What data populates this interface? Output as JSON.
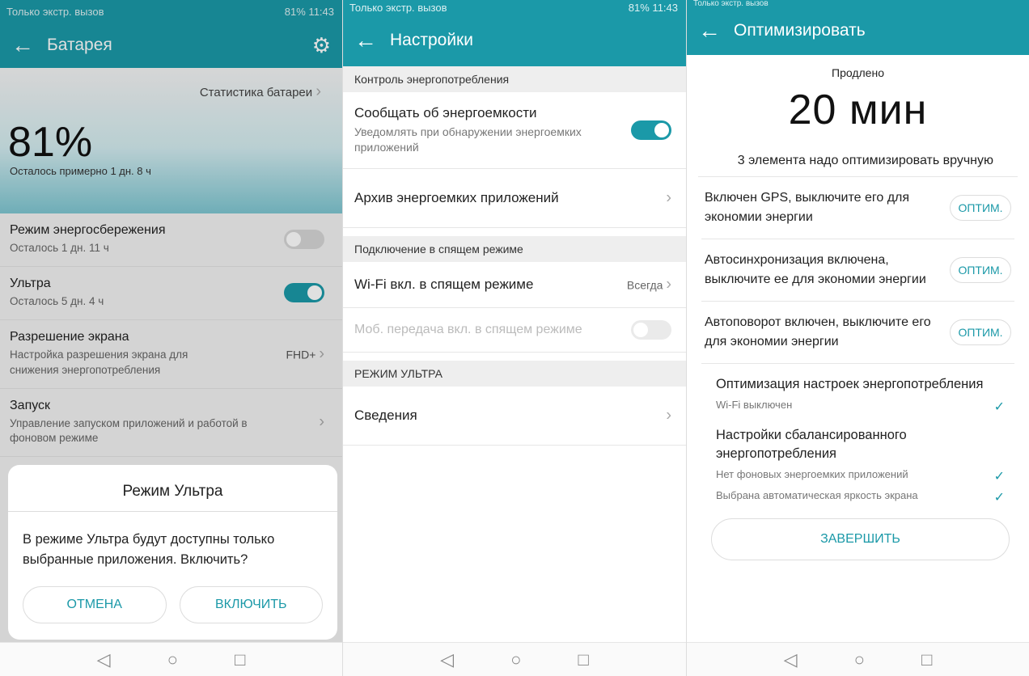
{
  "colors": {
    "accent": "#1b99a8",
    "section_bg": "#eeeeee"
  },
  "phone1": {
    "status": {
      "left": "Только экстр. вызов",
      "right": "81% 11:43"
    },
    "title": "Батарея",
    "stats_link": "Статистика батареи",
    "percent": "81%",
    "remaining": "Осталось примерно 1 дн. 8 ч",
    "rows": [
      {
        "title": "Режим энергосбережения",
        "sub": "Осталось 1 дн. 11 ч",
        "toggle_on": false
      },
      {
        "title": "Ультра",
        "sub": "Осталось 5 дн. 4 ч",
        "toggle_on": true
      },
      {
        "title": "Разрешение экрана",
        "sub": "Настройка разрешения экрана для снижения энергопотребления",
        "value": "FHD+"
      },
      {
        "title": "Запуск",
        "sub": "Управление запуском приложений и работой в фоновом режиме"
      }
    ],
    "dialog": {
      "title": "Режим Ультра",
      "message": "В режиме Ультра будут доступны только выбранные приложения. Включить?",
      "cancel": "ОТМЕНА",
      "enable": "ВКЛЮЧИТЬ"
    }
  },
  "phone2": {
    "status": {
      "left": "Только экстр. вызов",
      "right": "81% 11:43"
    },
    "title": "Настройки",
    "section1": "Контроль энергопотребления",
    "notify": {
      "title": "Сообщать об энергоемкости",
      "sub": "Уведомлять при обнаружении энергоемких приложений",
      "toggle_on": true
    },
    "archive": "Архив энергоемких приложений",
    "section2": "Подключение в спящем режиме",
    "wifi": {
      "title": "Wi-Fi вкл. в спящем режиме",
      "value": "Всегда"
    },
    "mobile": {
      "title": "Моб. передача вкл. в спящем режиме",
      "toggle_on": false
    },
    "section3": "РЕЖИМ УЛЬТРА",
    "info": "Сведения"
  },
  "phone3": {
    "status": {
      "left": "Только экстр. вызов"
    },
    "title": "Оптимизировать",
    "extended_label": "Продлено",
    "extended_value": "20 мин",
    "manual_header": "3 элемента надо оптимизировать вручную",
    "items": [
      {
        "text": "Включен GPS, выключите его для экономии энергии",
        "button": "ОПТИМ."
      },
      {
        "text": "Автосинхронизация включена, выключите ее для экономии энергии",
        "button": "ОПТИМ."
      },
      {
        "text": "Автоповорот включен, выключите его для экономии энергии",
        "button": "ОПТИМ."
      }
    ],
    "done1": {
      "title": "Оптимизация настроек энергопотребления",
      "lines": [
        "Wi-Fi выключен"
      ]
    },
    "done2": {
      "title": "Настройки сбалансированного энергопотребления",
      "lines": [
        "Нет фоновых энергоемких приложений",
        "Выбрана автоматическая яркость экрана"
      ]
    },
    "finish": "ЗАВЕРШИТЬ"
  }
}
